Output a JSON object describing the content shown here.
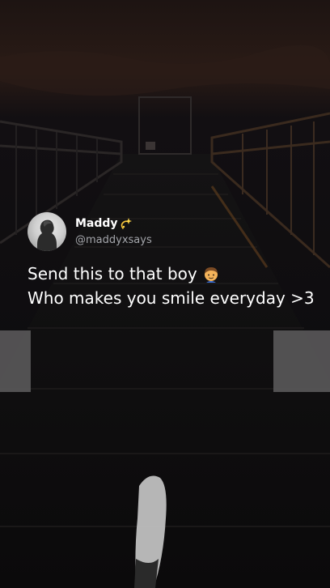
{
  "tweet": {
    "display_name": "Maddy",
    "handle": "@maddyxsays",
    "line_1": "Send this to that boy",
    "line_2": "Who makes you smile everyday >3"
  },
  "icons": {
    "avatar": "profile-avatar",
    "name_emoji": "dizzy-sparkle-icon",
    "text_emoji": "boy-emoji-icon"
  },
  "colors": {
    "text_primary": "#ffffff",
    "text_secondary": "#a3a5aa",
    "background": "#07070a"
  }
}
